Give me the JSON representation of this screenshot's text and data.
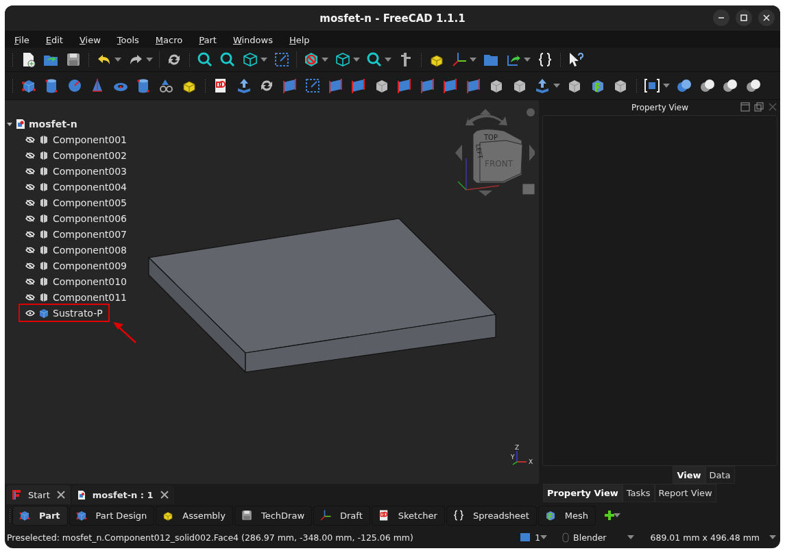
{
  "window": {
    "title": "mosfet-n - FreeCAD 1.1.1"
  },
  "menu": [
    "File",
    "Edit",
    "View",
    "Tools",
    "Macro",
    "Part",
    "Windows",
    "Help"
  ],
  "tree": {
    "label": "mosfet-n",
    "expanded": true,
    "children": [
      {
        "label": "Component001",
        "visible": false,
        "highlighted": false
      },
      {
        "label": "Component002",
        "visible": false,
        "highlighted": false
      },
      {
        "label": "Component003",
        "visible": false,
        "highlighted": false
      },
      {
        "label": "Component004",
        "visible": false,
        "highlighted": false
      },
      {
        "label": "Component005",
        "visible": false,
        "highlighted": false
      },
      {
        "label": "Component006",
        "visible": false,
        "highlighted": false
      },
      {
        "label": "Component007",
        "visible": false,
        "highlighted": false
      },
      {
        "label": "Component008",
        "visible": false,
        "highlighted": false
      },
      {
        "label": "Component009",
        "visible": false,
        "highlighted": false
      },
      {
        "label": "Component010",
        "visible": false,
        "highlighted": false
      },
      {
        "label": "Component011",
        "visible": false,
        "highlighted": false
      },
      {
        "label": "Sustrato-P",
        "visible": true,
        "highlighted": true
      }
    ]
  },
  "nav_cube": {
    "top": "TOP",
    "front": "FRONT",
    "left": "LEFT"
  },
  "axes": {
    "z": "Z",
    "y": "Y",
    "x": "X"
  },
  "property_panel": {
    "title": "Property View",
    "tabs": [
      {
        "label": "View",
        "selected": true
      },
      {
        "label": "Data",
        "selected": false
      }
    ]
  },
  "panel_tabs": [
    {
      "label": "Property View",
      "selected": true
    },
    {
      "label": "Tasks",
      "selected": false
    },
    {
      "label": "Report View",
      "selected": false
    }
  ],
  "doc_tabs": [
    {
      "label": "Start",
      "kind": "start",
      "selected": false
    },
    {
      "label": "mosfet-n : 1",
      "kind": "document",
      "selected": true
    }
  ],
  "workbenches": [
    {
      "label": "Part",
      "kind": "part",
      "selected": true
    },
    {
      "label": "Part Design",
      "kind": "partdesign",
      "selected": false
    },
    {
      "label": "Assembly",
      "kind": "assembly",
      "selected": false
    },
    {
      "label": "TechDraw",
      "kind": "techdraw",
      "selected": false
    },
    {
      "label": "Draft",
      "kind": "draft",
      "selected": false
    },
    {
      "label": "Sketcher",
      "kind": "sketcher",
      "selected": false
    },
    {
      "label": "Spreadsheet",
      "kind": "spreadsheet",
      "selected": false
    },
    {
      "label": "Mesh",
      "kind": "mesh",
      "selected": false
    }
  ],
  "status_bar": {
    "message": "Preselected: mosfet_n.Component012_solid002.Face4 (286.97 mm, -348.00 mm, -125.06 mm)",
    "views": "1",
    "navigation": "Blender",
    "dimensions": "689.01 mm x 496.48 mm"
  }
}
